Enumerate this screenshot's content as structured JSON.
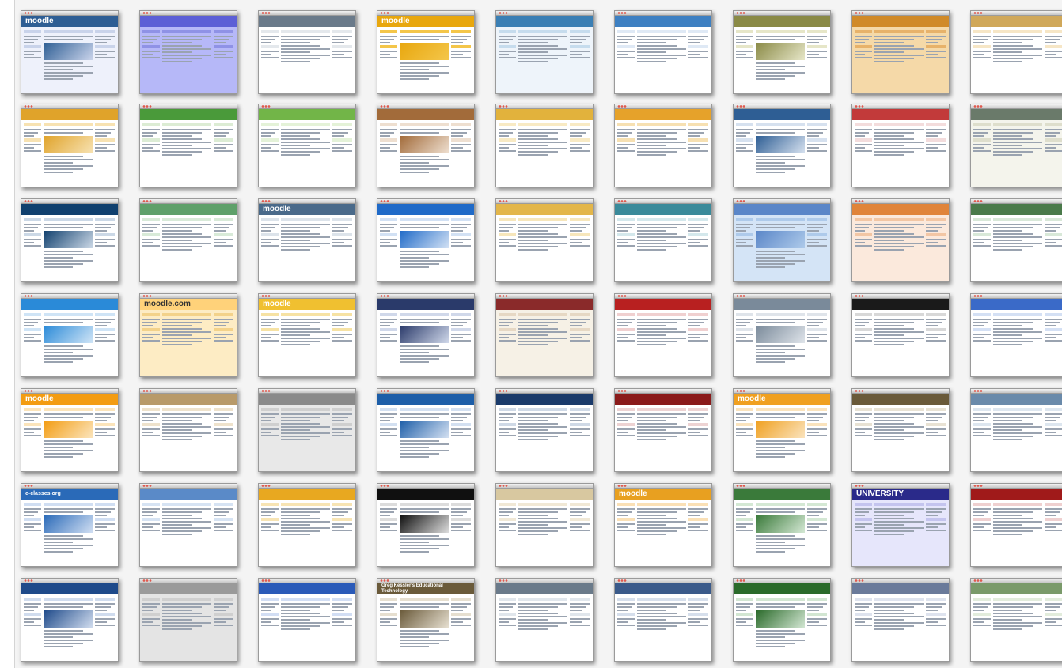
{
  "tiles": [
    {
      "logo": "moodle",
      "theme": "#2e5e94",
      "bg": "#eef1fb",
      "panel": "#c9d3ea"
    },
    {
      "logo": "",
      "theme": "#5c5fd6",
      "bg": "#b6b8f8",
      "panel": "#8f92e6"
    },
    {
      "logo": "",
      "theme": "#6a7a8a",
      "bg": "#ffffff",
      "panel": "#e4e8ec"
    },
    {
      "logo": "moodle",
      "theme": "#e8a70e",
      "bg": "#ffffff",
      "panel": "#f4c64a"
    },
    {
      "logo": "",
      "theme": "#3b7fb4",
      "bg": "#eef4fa",
      "panel": "#c6dced"
    },
    {
      "logo": "",
      "theme": "#3e80c2",
      "bg": "#ffffff",
      "panel": "#dfe9f5"
    },
    {
      "logo": "",
      "theme": "#8a8a46",
      "bg": "#ffffff",
      "panel": "#e6e6c8"
    },
    {
      "logo": "",
      "theme": "#d08a28",
      "bg": "#f5d9a8",
      "panel": "#e7b26a"
    },
    {
      "logo": "",
      "theme": "#d0a85a",
      "bg": "#ffffff",
      "panel": "#f6e6c6"
    },
    {
      "logo": "",
      "theme": "#e0a32a",
      "bg": "#ffffff",
      "panel": "#f7e2b2"
    },
    {
      "logo": "",
      "theme": "#4a9a3a",
      "bg": "#ffffff",
      "panel": "#dcecd4"
    },
    {
      "logo": "",
      "theme": "#72b548",
      "bg": "#ffffff",
      "panel": "#e4f2d8"
    },
    {
      "logo": "",
      "theme": "#a26b3a",
      "bg": "#ffffff",
      "panel": "#eedfd0"
    },
    {
      "logo": "",
      "theme": "#e2b23c",
      "bg": "#ffffff",
      "panel": "#f8eac4"
    },
    {
      "logo": "",
      "theme": "#e6a22a",
      "bg": "#ffffff",
      "panel": "#f6e0b2"
    },
    {
      "logo": "",
      "theme": "#2e5e94",
      "bg": "#ffffff",
      "panel": "#d6e1ef"
    },
    {
      "logo": "",
      "theme": "#c23a3a",
      "bg": "#ffffff",
      "panel": "#f3dcdc"
    },
    {
      "logo": "",
      "theme": "#6a7a6a",
      "bg": "#f4f4ec",
      "panel": "#dedecc"
    },
    {
      "logo": "",
      "theme": "#10406e",
      "bg": "#ffffff",
      "panel": "#cbd8e6"
    },
    {
      "logo": "",
      "theme": "#5ea06a",
      "bg": "#ffffff",
      "panel": "#d8ead8"
    },
    {
      "logo": "moodle",
      "theme": "#4a6a8a",
      "bg": "#ffffff",
      "panel": "#dce3ea"
    },
    {
      "logo": "",
      "theme": "#1f6ac8",
      "bg": "#ffffff",
      "panel": "#d2e1f4"
    },
    {
      "logo": "",
      "theme": "#e3b64a",
      "bg": "#ffffff",
      "panel": "#f6e6bb"
    },
    {
      "logo": "",
      "theme": "#3a8a9a",
      "bg": "#ffffff",
      "panel": "#d4e8ec"
    },
    {
      "logo": "",
      "theme": "#5a86c8",
      "bg": "#d4e4f6",
      "panel": "#aecaea"
    },
    {
      "logo": "",
      "theme": "#e0843a",
      "bg": "#fbe9dc",
      "panel": "#f2c6a4"
    },
    {
      "logo": "",
      "theme": "#4a7a4a",
      "bg": "#ffffff",
      "panel": "#d8e8d8"
    },
    {
      "logo": "",
      "theme": "#2a8ad8",
      "bg": "#ffffff",
      "panel": "#cfe4f6"
    },
    {
      "logo": "moodle.com",
      "theme": "#ffd27a",
      "bg": "#fdecc4",
      "panel": "#f3d28a"
    },
    {
      "logo": "moodle",
      "theme": "#f0c030",
      "bg": "#ffffff",
      "panel": "#f6e2a4"
    },
    {
      "logo": "",
      "theme": "#2a3a6a",
      "bg": "#ffffff",
      "panel": "#d0d8ea"
    },
    {
      "logo": "",
      "theme": "#8a2a2a",
      "bg": "#f6f1e6",
      "panel": "#e6d8c4"
    },
    {
      "logo": "",
      "theme": "#b82020",
      "bg": "#ffffff",
      "panel": "#f0d0d0"
    },
    {
      "logo": "",
      "theme": "#7a8a9a",
      "bg": "#ffffff",
      "panel": "#dfe4ea"
    },
    {
      "logo": "",
      "theme": "#1a1a1a",
      "bg": "#ffffff",
      "panel": "#d8d8d8"
    },
    {
      "logo": "",
      "theme": "#3a6ac8",
      "bg": "#ffffff",
      "panel": "#d4e0f4"
    },
    {
      "logo": "moodle",
      "theme": "#f39c12",
      "bg": "#ffffff",
      "panel": "#fbe4bb"
    },
    {
      "logo": "",
      "theme": "#b89a6a",
      "bg": "#ffffff",
      "panel": "#eee2cc"
    },
    {
      "logo": "",
      "theme": "#8a8a8a",
      "bg": "#e8e8e8",
      "panel": "#cfcfcf"
    },
    {
      "logo": "",
      "theme": "#1d5ea8",
      "bg": "#ffffff",
      "panel": "#d3e0f1"
    },
    {
      "logo": "",
      "theme": "#1a3a6a",
      "bg": "#ffffff",
      "panel": "#cfd9e6"
    },
    {
      "logo": "",
      "theme": "#8a1a1a",
      "bg": "#ffffff",
      "panel": "#edd3d3"
    },
    {
      "logo": "moodle",
      "theme": "#f0a020",
      "bg": "#ffffff",
      "panel": "#fae3bd"
    },
    {
      "logo": "",
      "theme": "#6a5a3a",
      "bg": "#ffffff",
      "panel": "#e8e2d4"
    },
    {
      "logo": "",
      "theme": "#6a8aaa",
      "bg": "#ffffff",
      "panel": "#dde6ef"
    },
    {
      "logo": "e-classes.org",
      "theme": "#2a6ab8",
      "bg": "#ffffff",
      "panel": "#d0def2"
    },
    {
      "logo": "",
      "theme": "#5a8ac8",
      "bg": "#ffffff",
      "panel": "#d6e3f3"
    },
    {
      "logo": "",
      "theme": "#e8a820",
      "bg": "#ffffff",
      "panel": "#f7e4b4"
    },
    {
      "logo": "",
      "theme": "#101010",
      "bg": "#ffffff",
      "panel": "#dcdcdc"
    },
    {
      "logo": "",
      "theme": "#d8c8a0",
      "bg": "#ffffff",
      "panel": "#f0e8d6"
    },
    {
      "logo": "moodle",
      "theme": "#e8a020",
      "bg": "#ffffff",
      "panel": "#fae0b6"
    },
    {
      "logo": "",
      "theme": "#3a7a3a",
      "bg": "#ffffff",
      "panel": "#d4e8d4"
    },
    {
      "logo": "UNIVERSITY",
      "theme": "#2a2a8a",
      "bg": "#e6e6fb",
      "panel": "#c4c4ee"
    },
    {
      "logo": "",
      "theme": "#a01a1a",
      "bg": "#ffffff",
      "panel": "#efd0d0"
    },
    {
      "logo": "",
      "theme": "#1e4a8a",
      "bg": "#ffffff",
      "panel": "#d0dcee"
    },
    {
      "logo": "",
      "theme": "#9a9a9a",
      "bg": "#e4e4e4",
      "panel": "#cfcfcf"
    },
    {
      "logo": "",
      "theme": "#2a5ab8",
      "bg": "#ffffff",
      "panel": "#d2def4"
    },
    {
      "logo": "Greg Kessler's Educational Technology",
      "theme": "#6a5a3a",
      "bg": "#ffffff",
      "panel": "#e6dfd0"
    },
    {
      "logo": "",
      "theme": "#6a7a8a",
      "bg": "#ffffff",
      "panel": "#e0e6ec"
    },
    {
      "logo": "",
      "theme": "#3a5a8a",
      "bg": "#ffffff",
      "panel": "#d6dfec"
    },
    {
      "logo": "",
      "theme": "#2a6a2a",
      "bg": "#ffffff",
      "panel": "#d2e6d2"
    },
    {
      "logo": "",
      "theme": "#6a7a9a",
      "bg": "#ffffff",
      "panel": "#dee3ee"
    },
    {
      "logo": "",
      "theme": "#7a9a6a",
      "bg": "#ffffff",
      "panel": "#e2ecdc"
    }
  ]
}
